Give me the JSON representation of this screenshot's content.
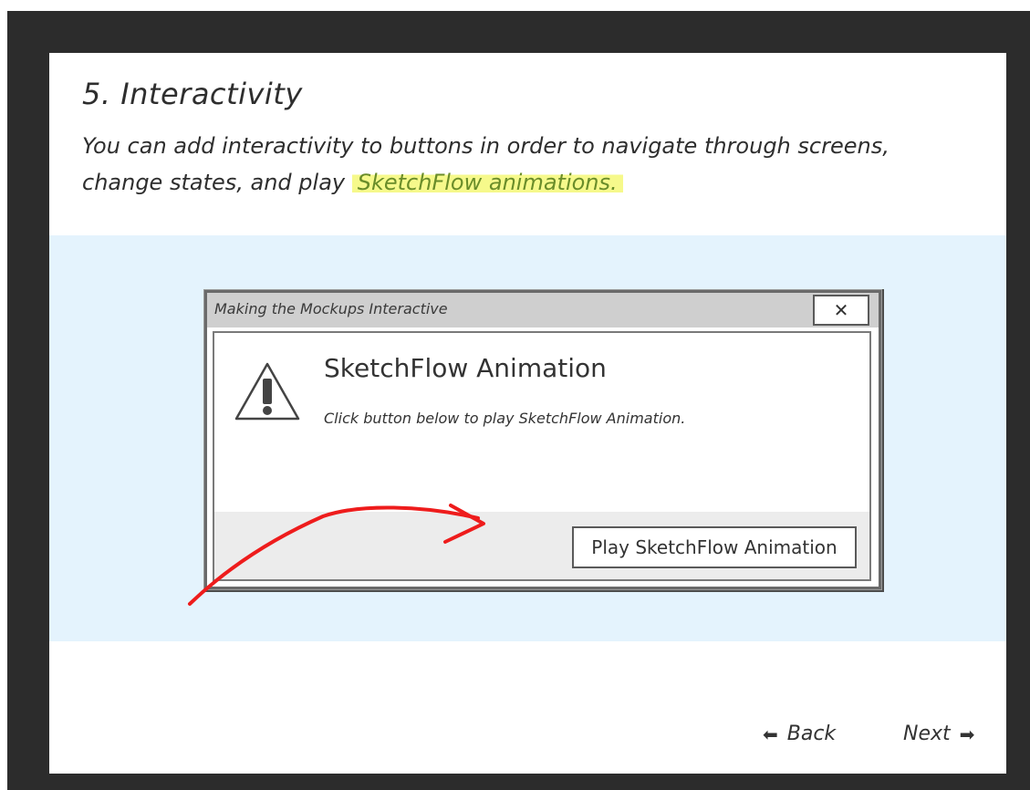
{
  "slide": {
    "title": "5. Interactivity",
    "description_prefix": "You can add interactivity to buttons in order to navigate through screens, change states, and play ",
    "description_highlight": "SketchFlow animations."
  },
  "dialog": {
    "window_title": "Making the Mockups Interactive",
    "close_glyph": "✕",
    "heading": "SketchFlow Animation",
    "message": "Click button below to play SketchFlow Animation.",
    "play_button_label": "Play SketchFlow Animation",
    "icon": "warning-icon"
  },
  "navigation": {
    "back_label": "Back",
    "back_icon": "arrow-left-icon",
    "next_label": "Next",
    "next_icon": "arrow-right-icon"
  },
  "colors": {
    "frame": "#2c2c2c",
    "band": "#e4f3fd",
    "highlight": "#f6f98b",
    "highlight_text": "#6a8d2a",
    "annotation_arrow": "#ee1c1c"
  }
}
